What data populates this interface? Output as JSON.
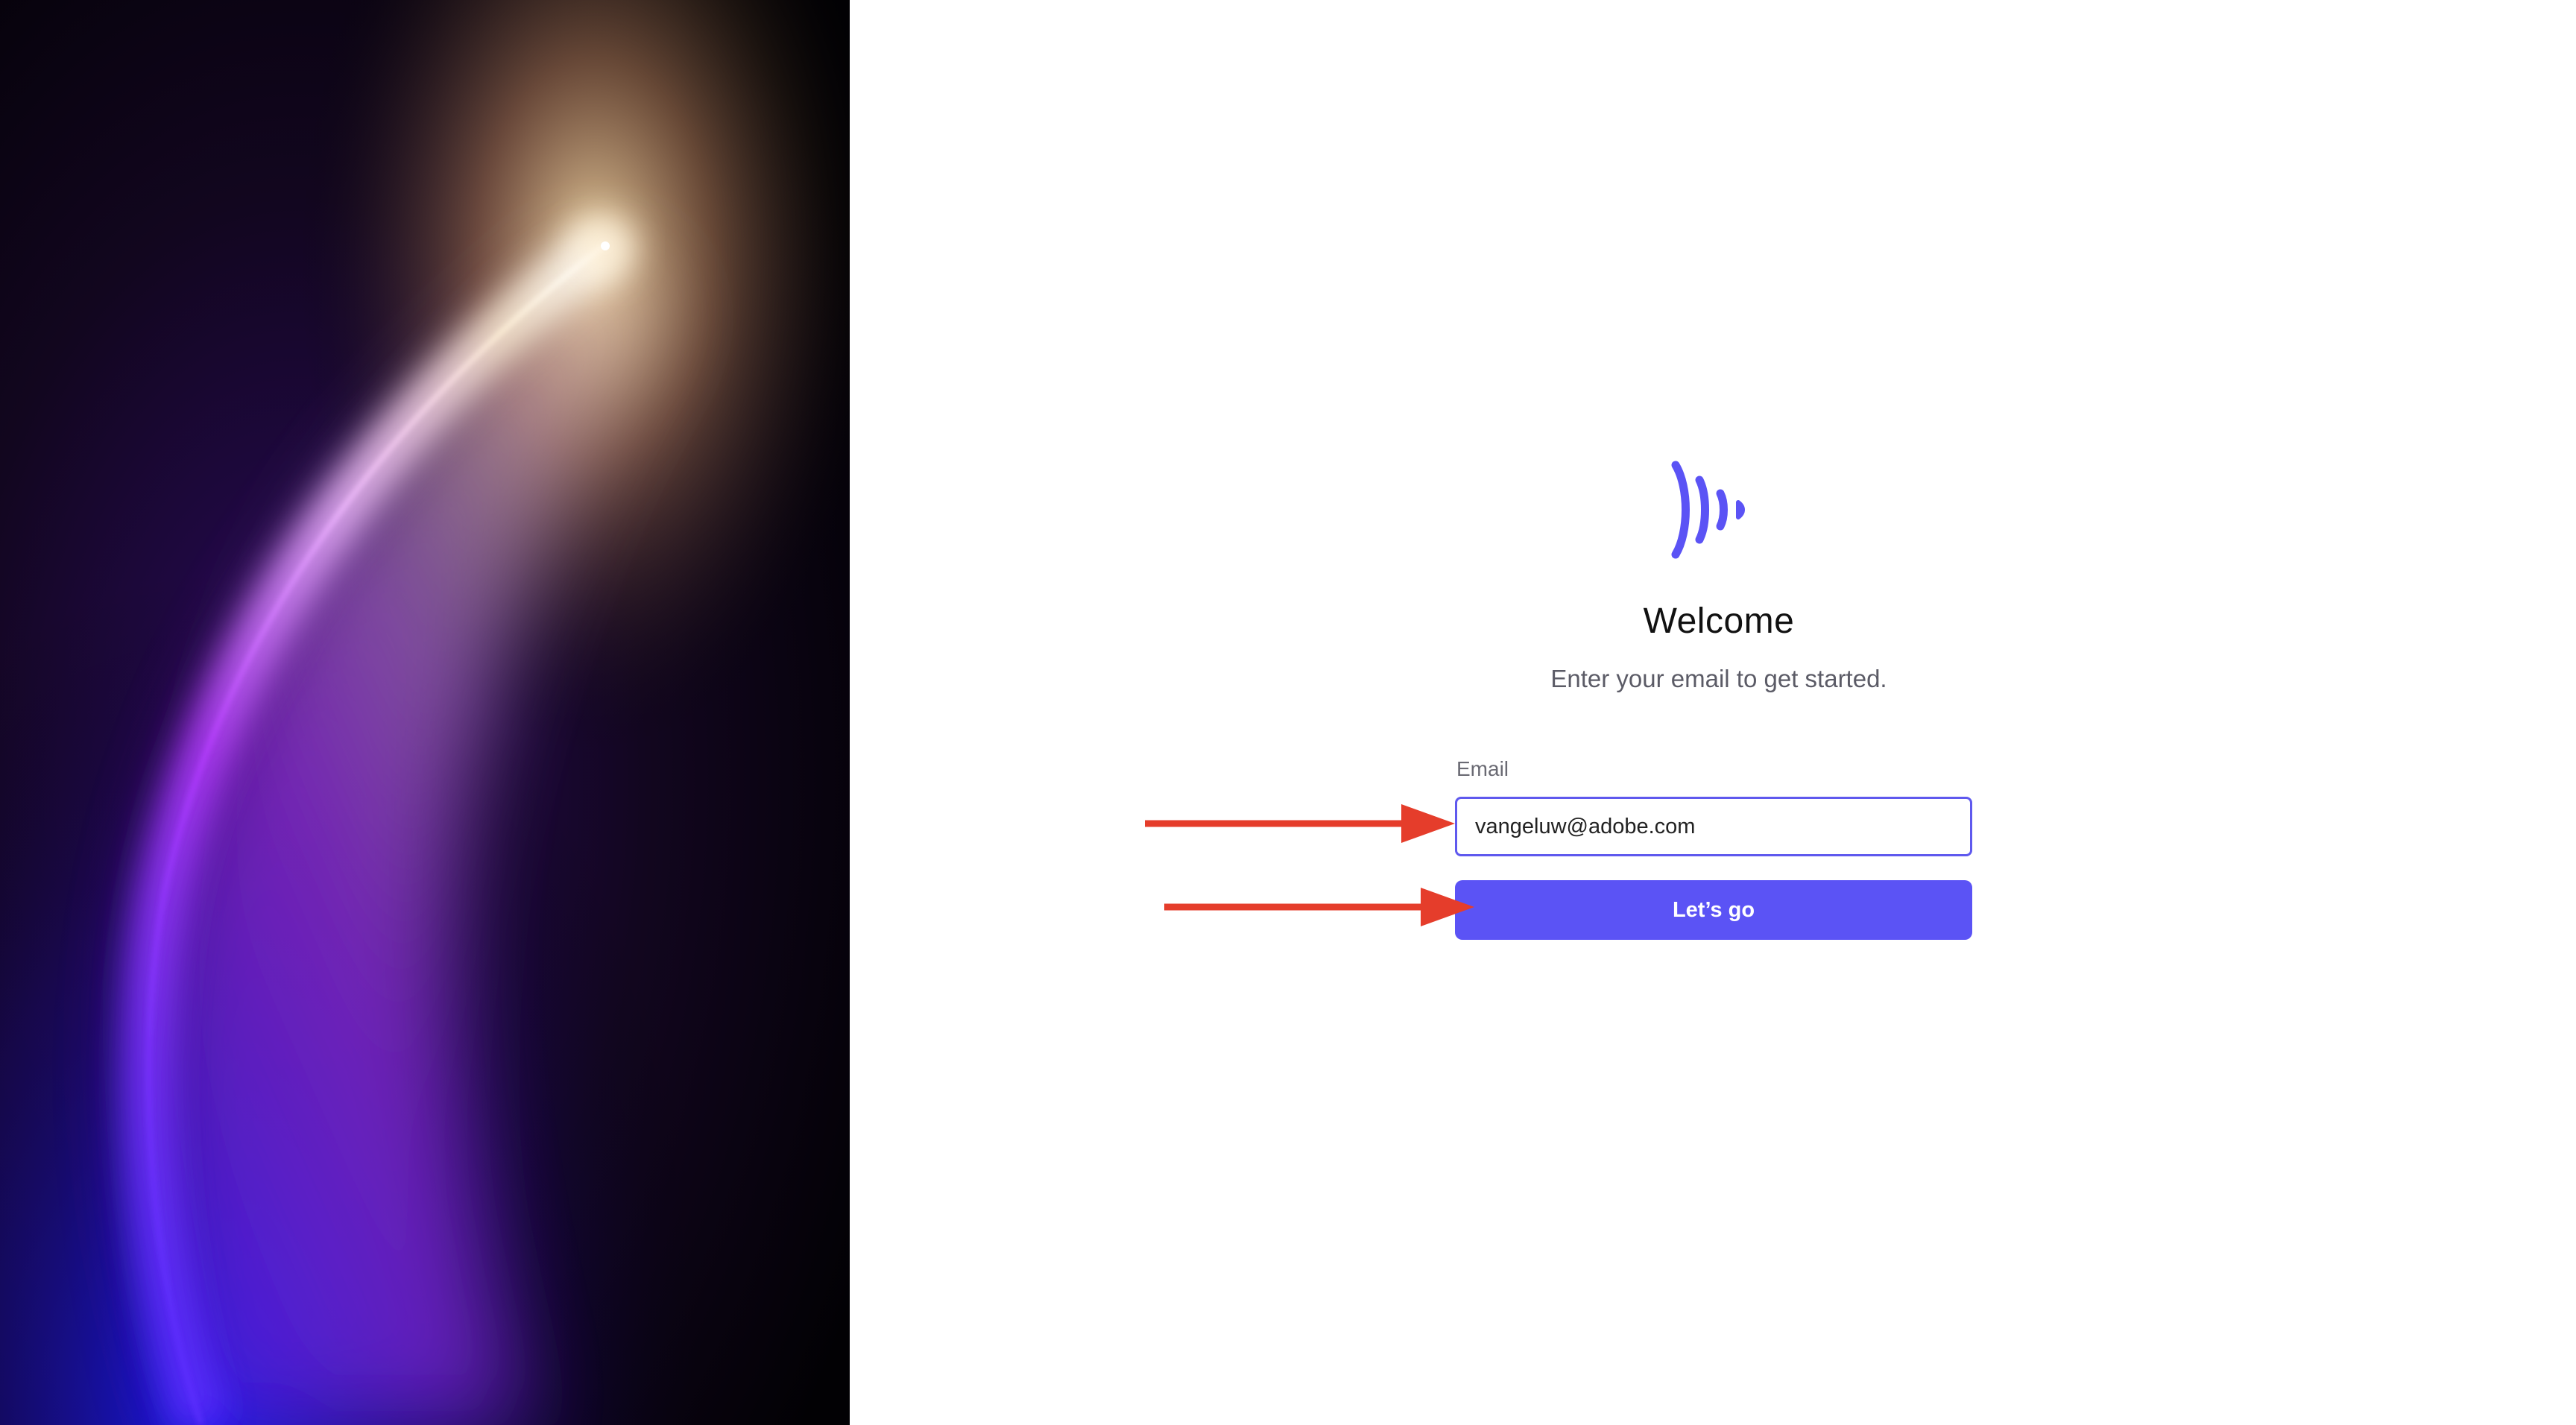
{
  "welcome": {
    "title": "Welcome",
    "subtitle": "Enter your email to get started."
  },
  "email": {
    "label": "Email",
    "value": "vangeluw@adobe.com",
    "placeholder": ""
  },
  "submit": {
    "label": "Let’s go"
  },
  "colors": {
    "accent": "#5b53f5",
    "annotation_arrow": "#e53d2b",
    "input_focus_border": "#5f59ee"
  },
  "icons": {
    "logo": "sound-waves-logo-icon",
    "arrows": "red-annotation-arrow-icon"
  }
}
